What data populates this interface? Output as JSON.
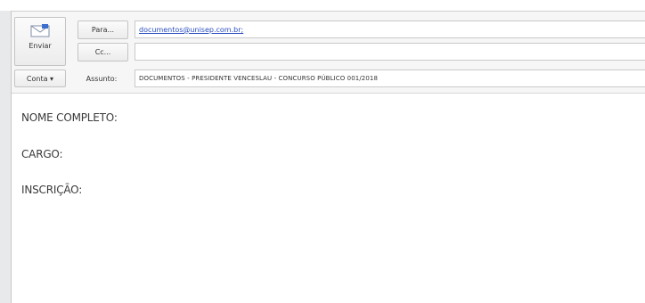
{
  "compose": {
    "send_label": "Enviar",
    "to_button_label": "Para...",
    "cc_button_label": "Cc...",
    "account_button_label": "Conta ▾",
    "subject_label": "Assunto:",
    "to_value": "documentos@unisep.com.br;",
    "cc_value": "",
    "subject_value": "DOCUMENTOS - PRESIDENTE VENCESLAU - CONCURSO PÚBLICO 001/2018"
  },
  "body": {
    "lines": [
      "NOME COMPLETO:",
      "CARGO:",
      "INSCRIÇÃO:"
    ]
  },
  "icons": {
    "send": "send-icon"
  }
}
